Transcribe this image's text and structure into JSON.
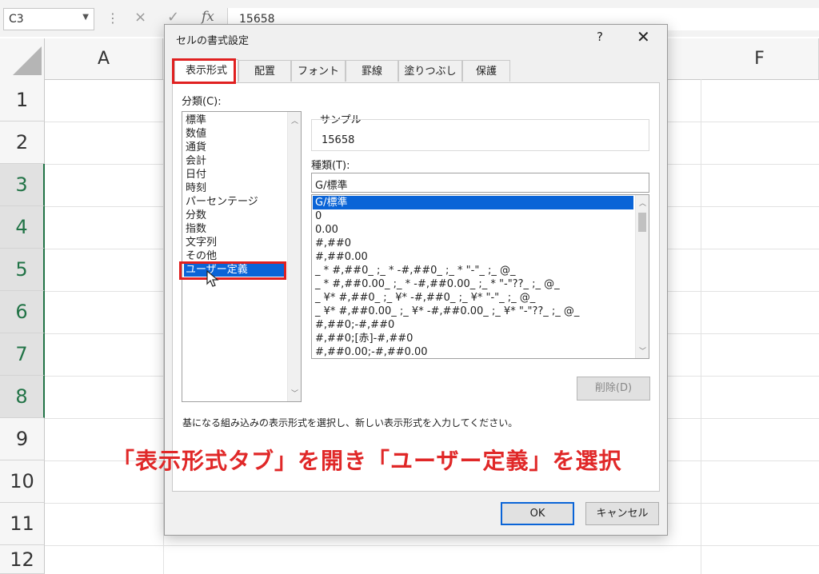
{
  "formula_bar": {
    "name_box": "C3",
    "cancel_icon": "×",
    "enter_icon": "✓",
    "fx_label": "fx",
    "formula_value": "15658"
  },
  "columns": [
    "A",
    "F"
  ],
  "rows": [
    "1",
    "2",
    "3",
    "4",
    "5",
    "6",
    "7",
    "8",
    "9",
    "10",
    "11",
    "12"
  ],
  "dialog": {
    "title": "セルの書式設定",
    "help": "?",
    "close": "✕",
    "tabs": [
      "表示形式",
      "配置",
      "フォント",
      "罫線",
      "塗りつぶし",
      "保護"
    ],
    "category_label": "分類(C):",
    "categories": [
      "標準",
      "数値",
      "通貨",
      "会計",
      "日付",
      "時刻",
      "パーセンテージ",
      "分数",
      "指数",
      "文字列",
      "その他",
      "ユーザー定義"
    ],
    "selected_category": "ユーザー定義",
    "sample_label": "サンプル",
    "sample_value": "15658",
    "type_label": "種類(T):",
    "type_value": "G/標準",
    "formats": [
      "G/標準",
      "0",
      "0.00",
      "#,##0",
      "#,##0.00",
      "_ * #,##0_ ;_ * -#,##0_ ;_ * \"-\"_ ;_ @_",
      "_ * #,##0.00_ ;_ * -#,##0.00_ ;_ * \"-\"??_ ;_ @_",
      "_ ¥* #,##0_ ;_ ¥* -#,##0_ ;_ ¥* \"-\"_ ;_ @_",
      "_ ¥* #,##0.00_ ;_ ¥* -#,##0.00_ ;_ ¥* \"-\"??_ ;_ @_",
      "#,##0;-#,##0",
      "#,##0;[赤]-#,##0",
      "#,##0.00;-#,##0.00"
    ],
    "delete_button": "削除(D)",
    "description": "基になる組み込みの表示形式を選択し、新しい表示形式を入力してください。",
    "ok_button": "OK",
    "cancel_button": "キャンセル"
  },
  "annotation": "「表示形式タブ」を開き「ユーザー定義」を選択",
  "colors": {
    "highlight_red": "#e02020",
    "selection_blue": "#0a64d7",
    "excel_green": "#217346"
  }
}
